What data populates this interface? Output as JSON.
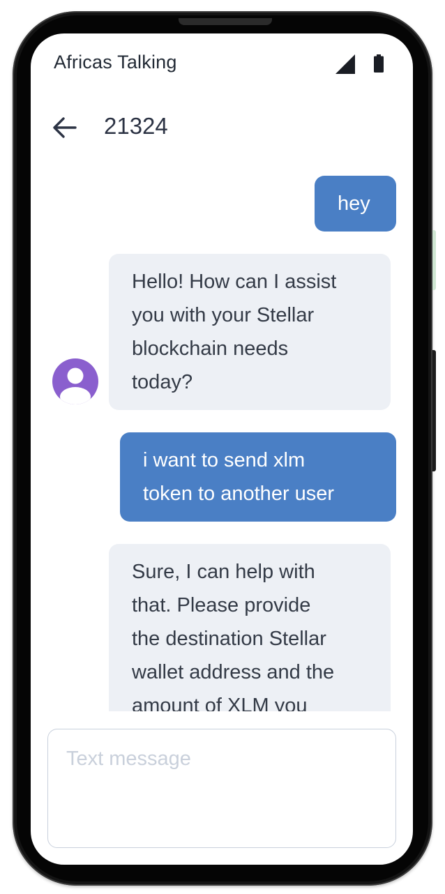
{
  "status_bar": {
    "title": "Africas Talking",
    "icons": [
      "signal-icon",
      "battery-icon"
    ]
  },
  "app_bar": {
    "back_icon": "arrow-left-icon",
    "title": "21324"
  },
  "messages": [
    {
      "direction": "outgoing",
      "text": "hey"
    },
    {
      "direction": "incoming",
      "text": "Hello! How can I assist\nyou with your Stellar\nblockchain needs\ntoday?"
    },
    {
      "direction": "outgoing",
      "text": "i want to send xlm\ntoken to another user"
    },
    {
      "direction": "incoming",
      "text": "Sure, I can help with\nthat. Please provide\nthe destination Stellar\nwallet address and the\namount of XLM you"
    }
  ],
  "avatar_icon": "person-icon",
  "composer": {
    "placeholder": "Text message",
    "value": ""
  },
  "colors": {
    "outgoing_bubble": "#4a7fc5",
    "incoming_bubble": "#edf0f5",
    "avatar": "#8a5fce",
    "text": "#333a46"
  }
}
